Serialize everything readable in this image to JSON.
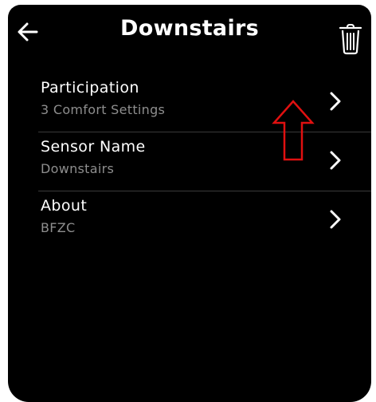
{
  "header": {
    "back_icon": "arrow-left-icon",
    "title": "Downstairs",
    "trash_icon": "trash-icon"
  },
  "rows": [
    {
      "label": "Participation",
      "sub": "3 Comfort Settings",
      "icon": "chevron-right-icon"
    },
    {
      "label": "Sensor Name",
      "sub": "Downstairs",
      "icon": "chevron-right-icon"
    },
    {
      "label": "About",
      "sub": "BFZC",
      "icon": "chevron-right-icon"
    }
  ],
  "annotation": {
    "icon": "up-arrow-icon",
    "color": "#e01010"
  },
  "colors": {
    "background": "#000000",
    "text": "#ffffff",
    "subtext": "#8e8e8e",
    "divider": "#3a3a3a"
  }
}
